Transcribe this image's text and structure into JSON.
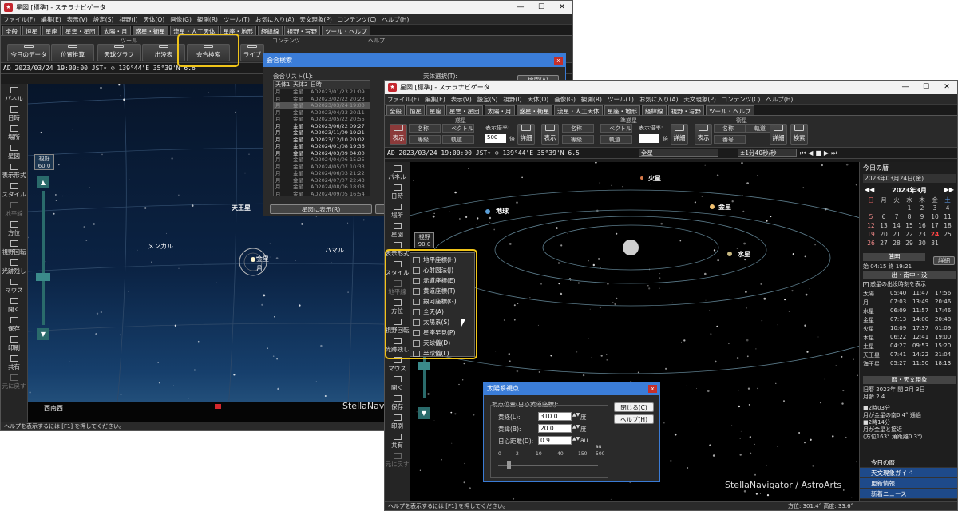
{
  "back": {
    "title": "星図 [標準] - ステラナビゲータ",
    "menu": [
      "ファイル(F)",
      "編集(E)",
      "表示(V)",
      "設定(S)",
      "視野(I)",
      "天体(O)",
      "画像(G)",
      "観測(R)",
      "ツール(T)",
      "お気に入り(A)",
      "天文現象(P)",
      "コンテンツ(C)",
      "ヘルプ(H)"
    ],
    "tabs": [
      "全般",
      "恒星",
      "星座",
      "星雲・星団",
      "太陽・月",
      "惑星・衛星",
      "流星・人工天体",
      "星座・地形",
      "経緯線",
      "視野・写野",
      "ツール・ヘルプ"
    ],
    "ribbon_groups": {
      "tools": "ツール",
      "contents": "コンテンツ",
      "help": "ヘルプ"
    },
    "ribbon_buttons": [
      "今日のデータ",
      "位置推算",
      "天球グラフ",
      "出没表",
      "会合検索",
      "ライブ"
    ],
    "addr": "AD 2023/03/24 19:00:00 JST▿ ⊙ 139°44'E 35°39'N  6.6",
    "sidebar": [
      "パネル",
      "日時",
      "場所",
      "星図",
      "表示形式",
      "スタイル",
      "地平線",
      "方位",
      "視野回転",
      "光跡残し",
      "マウス",
      "開く",
      "保存",
      "印刷",
      "共有",
      "元に戻す"
    ],
    "fov": {
      "label": "視野",
      "value": "60.0"
    },
    "labels": {
      "uranus": "天王星",
      "menkar": "メンカル",
      "venus": "金星",
      "moon": "月",
      "hamal": "ハマル",
      "horizon": "西南西",
      "brand": "StellaNav"
    },
    "status": "ヘルプを表示するには [F1] を押してください。"
  },
  "conj": {
    "title": "会合検索",
    "list_label": "会合リスト(L):",
    "cols": [
      "天体1",
      "天体2",
      "日時"
    ],
    "rows": [
      [
        "月",
        "金星",
        "AD2023/01/23 21:09"
      ],
      [
        "月",
        "金星",
        "AD2023/02/22 20:23"
      ],
      [
        "月",
        "金星",
        "AD2023/03/24 19:00"
      ],
      [
        "月",
        "金星",
        "AD2023/04/23 20:11"
      ],
      [
        "月",
        "金星",
        "AD2023/05/22 20:55"
      ],
      [
        "月",
        "金星",
        "AD2023/06/22 09:27"
      ],
      [
        "月",
        "金星",
        "AD2023/11/09 19:21"
      ],
      [
        "月",
        "金星",
        "AD2023/12/10 20:02"
      ],
      [
        "月",
        "金星",
        "AD2024/01/08 19:36"
      ],
      [
        "月",
        "金星",
        "AD2024/03/09 04:00"
      ],
      [
        "月",
        "金星",
        "AD2024/04/06 15:25"
      ],
      [
        "月",
        "金星",
        "AD2024/05/07 10:33"
      ],
      [
        "月",
        "金星",
        "AD2024/06/03 21:22"
      ],
      [
        "月",
        "金星",
        "AD2024/07/07 22:43"
      ],
      [
        "月",
        "金星",
        "AD2024/08/06 18:08"
      ],
      [
        "月",
        "金星",
        "AD2024/09/05 16:54"
      ]
    ],
    "target_label": "天体選択(T):",
    "search_btn": "検索(A)",
    "show_btn": "星図に表示(R)"
  },
  "front": {
    "title": "星図 [標準] - ステラナビゲータ",
    "menu": [
      "ファイル(F)",
      "編集(E)",
      "表示(V)",
      "設定(S)",
      "視野(I)",
      "天体(O)",
      "画像(G)",
      "観測(R)",
      "ツール(T)",
      "お気に入り(A)",
      "天文現象(P)",
      "コンテンツ(C)",
      "ヘルプ(H)"
    ],
    "tabs": [
      "全般",
      "恒星",
      "星座",
      "星雲・星団",
      "太陽・月",
      "惑星・衛星",
      "流星・人工天体",
      "星座・地形",
      "経緯線",
      "視野・写野",
      "ツール・ヘルプ"
    ],
    "ribbon_groups": {
      "planet": "惑星",
      "minor": "準惑星",
      "sat": "衛星"
    },
    "ribbon": {
      "show": "表示",
      "name": "名称",
      "orbit": "軌道",
      "etc": "等級",
      "vector": "ベクトル",
      "ratio": "表示倍率:",
      "ratio_val": "500",
      "times": "倍",
      "detail": "詳細",
      "number": "番号",
      "search": "検索"
    },
    "addr": "AD 2023/03/24 19:00:00 JST▿ ⊙ 139°44'E 35°39'N  6.5",
    "sky_select": "全星",
    "speed": "±1分40秒/秒",
    "sidebar": [
      "パネル",
      "日時",
      "場所",
      "星図",
      "表示形式",
      "スタイル",
      "地平線",
      "方位",
      "視野回転",
      "光跡残し",
      "マウス",
      "開く",
      "保存",
      "印刷",
      "共有",
      "元に戻す"
    ],
    "fov": {
      "label": "視野",
      "value": "90.0"
    },
    "popup": [
      "地平座標(H)",
      "心射図法(J)",
      "赤道座標(E)",
      "黄道座標(T)",
      "銀河座標(G)",
      "全天(A)",
      "太陽系(S)",
      "星座早見(P)",
      "天球儀(D)",
      "半球儀(L)"
    ],
    "labels": {
      "mars": "火星",
      "earth": "地球",
      "venus": "金星",
      "mercury": "水星",
      "brand": "StellaNavigator / AstroArts"
    },
    "status": "ヘルプを表示するには [F1] を押してください。",
    "status_right": "方位: 301.4°  高度: 33.6°",
    "solar": {
      "title": "太陽系視点",
      "group": "視点位置(日心黄道座標):",
      "lon_label": "黄経(L):",
      "lon": "310.0",
      "lat_label": "黄緯(B):",
      "lat": "20.0",
      "dist_label": "日心距離(D):",
      "dist": "0.9",
      "deg": "度",
      "au": "au",
      "scale": [
        "0",
        "2",
        "10",
        "40",
        "150",
        "500"
      ],
      "au_small": "au",
      "close": "閉じる(C)",
      "help": "ヘルプ(H)"
    },
    "panel": {
      "title": "今日の暦",
      "date": "2023年03月24日(金)",
      "month": "2023年3月",
      "weekdays": [
        "日",
        "月",
        "火",
        "水",
        "木",
        "金",
        "土"
      ],
      "weeks": [
        [
          "",
          "",
          "",
          "1",
          "2",
          "3",
          "4"
        ],
        [
          "5",
          "6",
          "7",
          "8",
          "9",
          "10",
          "11"
        ],
        [
          "12",
          "13",
          "14",
          "15",
          "16",
          "17",
          "18"
        ],
        [
          "19",
          "20",
          "21",
          "22",
          "23",
          "24",
          "25"
        ],
        [
          "26",
          "27",
          "28",
          "29",
          "30",
          "31",
          ""
        ]
      ],
      "twilight": "薄明",
      "twilight_row": "始 04:15 終 19:21",
      "detail": "詳細",
      "rise_head": "出・南中・没",
      "rise_check": "惑星の出没時刻を表示",
      "rise": [
        [
          "太陽",
          "05:40",
          "11:47",
          "17:56"
        ],
        [
          "月",
          "07:03",
          "13:49",
          "20:46"
        ],
        [
          "水星",
          "06:09",
          "11:57",
          "17:46"
        ],
        [
          "金星",
          "07:13",
          "14:00",
          "20:48"
        ],
        [
          "火星",
          "10:09",
          "17:37",
          "01:09"
        ],
        [
          "木星",
          "06:22",
          "12:41",
          "19:00"
        ],
        [
          "土星",
          "04:27",
          "09:53",
          "15:20"
        ],
        [
          "天王星",
          "07:41",
          "14:22",
          "21:04"
        ],
        [
          "海王星",
          "05:27",
          "11:50",
          "18:13"
        ]
      ],
      "ev_head": "暦・天文現象",
      "ev1": "旧暦 2023年 閏 2月 3日",
      "ev2": "月齢 2.4",
      "ev3": "■2時03分",
      "ev4": "月が金星の南0.4° 通過",
      "ev5": "■2時14分",
      "ev6": "月が金星と接近",
      "ev7": "(方位163° 角距離0.3°)",
      "bottom": [
        "今日の暦",
        "天文現象ガイド",
        "更新情報",
        "新着ニュース"
      ]
    }
  }
}
